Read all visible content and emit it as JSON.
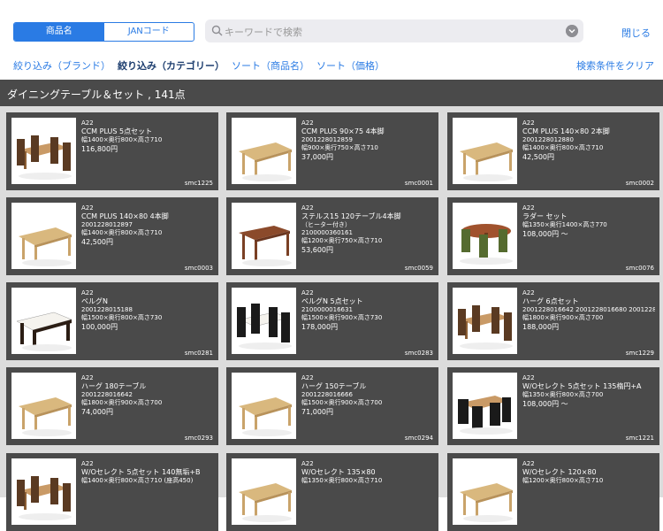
{
  "segment": {
    "product_name": "商品名",
    "jan_code": "JANコード"
  },
  "search": {
    "placeholder": "キーワードで検索"
  },
  "close_label": "閉じる",
  "filters": {
    "brand": "絞り込み（ブランド）",
    "category": "絞り込み（カテゴリー）",
    "sort_name": "ソート（商品名）",
    "sort_price": "ソート（価格）",
    "clear": "検索条件をクリア"
  },
  "header_title": "ダイニングテーブル＆セット , 141点",
  "products": [
    {
      "brand": "A22",
      "name": "CCM PLUS 5点セット",
      "jan": "",
      "size": "幅1400×奥行800×高さ710",
      "price": "116,800円",
      "code": "smc1225",
      "img": "set"
    },
    {
      "brand": "A22",
      "name": "CCM PLUS 90×75 4本脚",
      "jan": "2001228012859",
      "size": "幅900×奥行750×高さ710",
      "price": "37,000円",
      "code": "smc0001",
      "img": "table"
    },
    {
      "brand": "A22",
      "name": "CCM PLUS 140×80 2本脚",
      "jan": "2001228012880",
      "size": "幅1400×奥行800×高さ710",
      "price": "42,500円",
      "code": "smc0002",
      "img": "table"
    },
    {
      "brand": "A22",
      "name": "CCM PLUS 140×80 4本脚",
      "jan": "2001228012897",
      "size": "幅1400×奥行800×高さ710",
      "price": "42,500円",
      "code": "smc0003",
      "img": "table"
    },
    {
      "brand": "A22",
      "name": "ステルス15 120テーブル4本脚",
      "jan": "（ヒーター付き）",
      "size": "2100000360161",
      "size2": "幅1200×奥行750×高さ710",
      "price": "53,600円",
      "code": "smc0059",
      "img": "dark"
    },
    {
      "brand": "A22",
      "name": "ラダー セット",
      "jan": "",
      "size": "幅1350×奥行1400×高さ770",
      "price": "108,000円 〜",
      "code": "smc0076",
      "img": "round"
    },
    {
      "brand": "A22",
      "name": "ベルグN",
      "jan": "2001228015188",
      "size": "幅1500×奥行800×高さ730",
      "price": "100,000円",
      "code": "smc0281",
      "img": "white"
    },
    {
      "brand": "A22",
      "name": "ベルグN 5点セット",
      "jan": "2100000016631",
      "size": "幅1500×奥行900×高さ730",
      "price": "178,000円",
      "code": "smc0283",
      "img": "whiteset"
    },
    {
      "brand": "A22",
      "name": "ハーグ 6点セット",
      "jan": "2001228016642 2001228016680 2001228…",
      "size": "幅1800×奥行900×高さ700",
      "price": "188,000円",
      "code": "smc1229",
      "img": "set"
    },
    {
      "brand": "A22",
      "name": "ハーグ 180テーブル",
      "jan": "2001228016642",
      "size": "幅1800×奥行900×高さ700",
      "price": "74,000円",
      "code": "smc0293",
      "img": "table"
    },
    {
      "brand": "A22",
      "name": "ハーグ 150テーブル",
      "jan": "2001228016666",
      "size": "幅1500×奥行900×高さ700",
      "price": "71,000円",
      "code": "smc0294",
      "img": "table"
    },
    {
      "brand": "A22",
      "name": "W/Oセレクト 5点セット 135楕円+A",
      "jan": "",
      "size": "幅1350×奥行800×高さ700",
      "price": "108,000円 〜",
      "code": "smc1221",
      "img": "darkset"
    },
    {
      "brand": "A22",
      "name": "W/Oセレクト 5点セット 140無垢+B",
      "jan": "",
      "size": "幅1400×奥行800×高さ710 (座高450)",
      "price": "",
      "code": "",
      "img": "set"
    },
    {
      "brand": "A22",
      "name": "W/Oセレクト 135×80",
      "jan": "",
      "size": "幅1350×奥行800×高さ710",
      "price": "",
      "code": "",
      "img": "table"
    },
    {
      "brand": "A22",
      "name": "W/Oセレクト 120×80",
      "jan": "",
      "size": "幅1200×奥行800×高さ710",
      "price": "",
      "code": "",
      "img": "table"
    }
  ]
}
